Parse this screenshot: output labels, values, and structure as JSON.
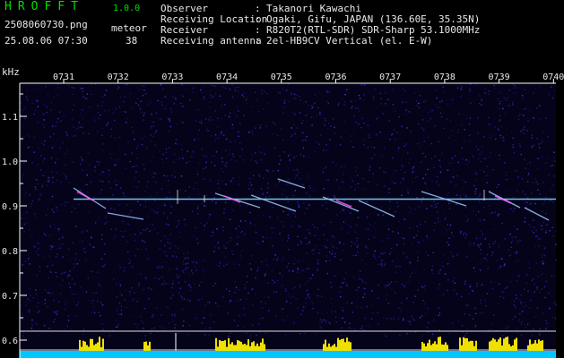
{
  "header": {
    "app_name": "HROFFT",
    "version": "1.0.0",
    "file_name": "2508060730.png",
    "meteor_label": "meteor",
    "date_time": "25.08.06 07:30",
    "meteor_count": "38"
  },
  "info": [
    {
      "label": "Observer",
      "sep": ":",
      "value": "Takanori Kawachi"
    },
    {
      "label": "Receiving Location",
      "sep": ":",
      "value": "Ogaki, Gifu, JAPAN (136.60E, 35.35N)"
    },
    {
      "label": "Receiver",
      "sep": ":",
      "value": "R820T2(RTL-SDR) SDR-Sharp 53.1000MHz"
    },
    {
      "label": "Receiving antenna",
      "sep": ":",
      "value": "2el-HB9CV Vertical (el. E-W)"
    }
  ],
  "spectrogram": {
    "unit_label": "kHz",
    "time_labels": [
      "0731",
      "0732",
      "0733",
      "0734",
      "0735",
      "0736",
      "0737",
      "0738",
      "0739",
      "0740"
    ],
    "freq_labels": [
      "1.1",
      "1.0",
      "0.9",
      "0.8",
      "0.7",
      "0.6"
    ],
    "freq_ticks": [
      1.15,
      1.1,
      1.05,
      1.0,
      0.95,
      0.9,
      0.85,
      0.8,
      0.75,
      0.7,
      0.65,
      0.6
    ],
    "carrier_khz": 0.915,
    "colors": {
      "text_green": "#00e000",
      "text_white": "#e8e8e8",
      "text_yellow": "#f0e000",
      "carrier": "#7fd8ff",
      "meteor": "#9ec8ff",
      "meteor_core": "#ff60ff",
      "noise": "#2a1f9a",
      "level_fill": "#00c8ff",
      "level_peak": "#f0e000"
    }
  }
}
